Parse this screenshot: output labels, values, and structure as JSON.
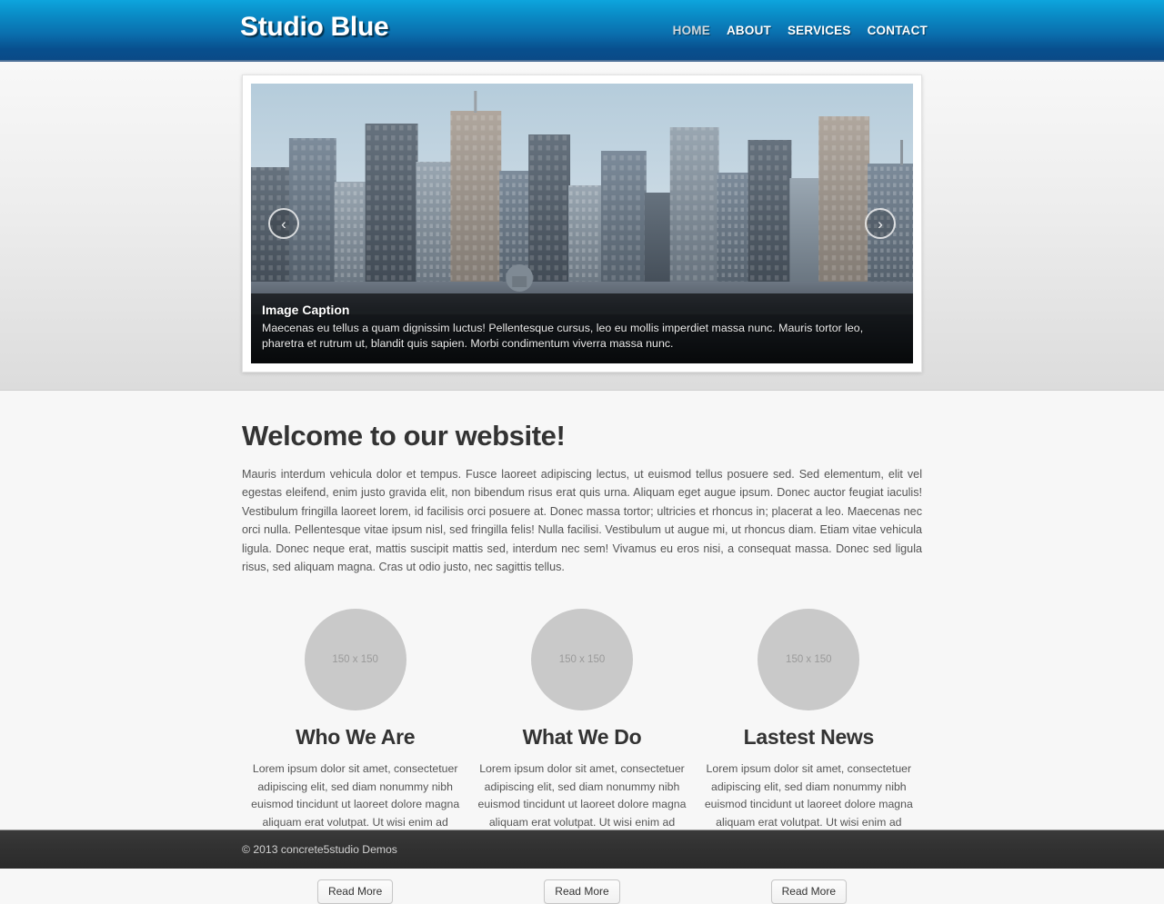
{
  "header": {
    "logo": "Studio Blue",
    "nav": [
      {
        "label": "HOME",
        "active": true
      },
      {
        "label": "ABOUT",
        "active": false
      },
      {
        "label": "SERVICES",
        "active": false
      },
      {
        "label": "CONTACT",
        "active": false
      }
    ]
  },
  "carousel": {
    "prev_icon": "‹",
    "next_icon": "›",
    "caption_title": "Image Caption",
    "caption_text": "Maecenas eu tellus a quam dignissim luctus! Pellentesque cursus, leo eu mollis imperdiet massa nunc. Mauris tortor leo, pharetra et rutrum ut, blandit quis sapien. Morbi condimentum viverra massa nunc."
  },
  "welcome": {
    "title": "Welcome to our website!",
    "body": "Mauris interdum vehicula dolor et tempus. Fusce laoreet adipiscing lectus, ut euismod tellus posuere sed. Sed elementum, elit vel egestas eleifend, enim justo gravida elit, non bibendum risus erat quis urna. Aliquam eget augue ipsum. Donec auctor feugiat iaculis! Vestibulum fringilla laoreet lorem, id facilisis orci posuere at. Donec massa tortor; ultricies et rhoncus in; placerat a leo. Maecenas nec orci nulla. Pellentesque vitae ipsum nisl, sed fringilla felis! Nulla facilisi. Vestibulum ut augue mi, ut rhoncus diam. Etiam vitae vehicula ligula. Donec neque erat, mattis suscipit mattis sed, interdum nec sem! Vivamus eu eros nisi, a consequat massa. Donec sed ligula risus, sed aliquam magna. Cras ut odio justo, nec sagittis tellus."
  },
  "columns": [
    {
      "image_placeholder": "150 x 150",
      "title": "Who We Are",
      "text": "Lorem ipsum dolor sit amet, consectetuer adipiscing elit, sed diam nonummy nibh euismod tincidunt ut laoreet dolore magna aliquam erat volutpat. Ut wisi enim ad minim veniam, quis nostrud exerci tation ullamcorper.",
      "button": "Read More"
    },
    {
      "image_placeholder": "150 x 150",
      "title": "What We Do",
      "text": "Lorem ipsum dolor sit amet, consectetuer adipiscing elit, sed diam nonummy nibh euismod tincidunt ut laoreet dolore magna aliquam erat volutpat. Ut wisi enim ad minim veniam, quis nostrud exerci tation ullamcorper.",
      "button": "Read More"
    },
    {
      "image_placeholder": "150 x 150",
      "title": "Lastest News",
      "text": "Lorem ipsum dolor sit amet, consectetuer adipiscing elit, sed diam nonummy nibh euismod tincidunt ut laoreet dolore magna aliquam erat volutpat. Ut wisi enim ad minim veniam, quis nostrud exerci tation ullamcorper.",
      "button": "Read More"
    }
  ],
  "footer": {
    "copyright": "© 2013 concrete5studio Demos"
  },
  "colors": {
    "header_top": "#0da5dd",
    "header_bottom": "#0a4a87",
    "header_border": "#4a6e96",
    "page_bg": "#f7f7f7",
    "hero_bg_top": "#f8f8f8",
    "hero_bg_bottom": "#dcdcdc",
    "heading": "#333333",
    "body_text": "#555555",
    "placeholder_circle": "#c9c9c9",
    "footer_bg": "#2e2e2e",
    "footer_text": "#d2d2d2"
  }
}
